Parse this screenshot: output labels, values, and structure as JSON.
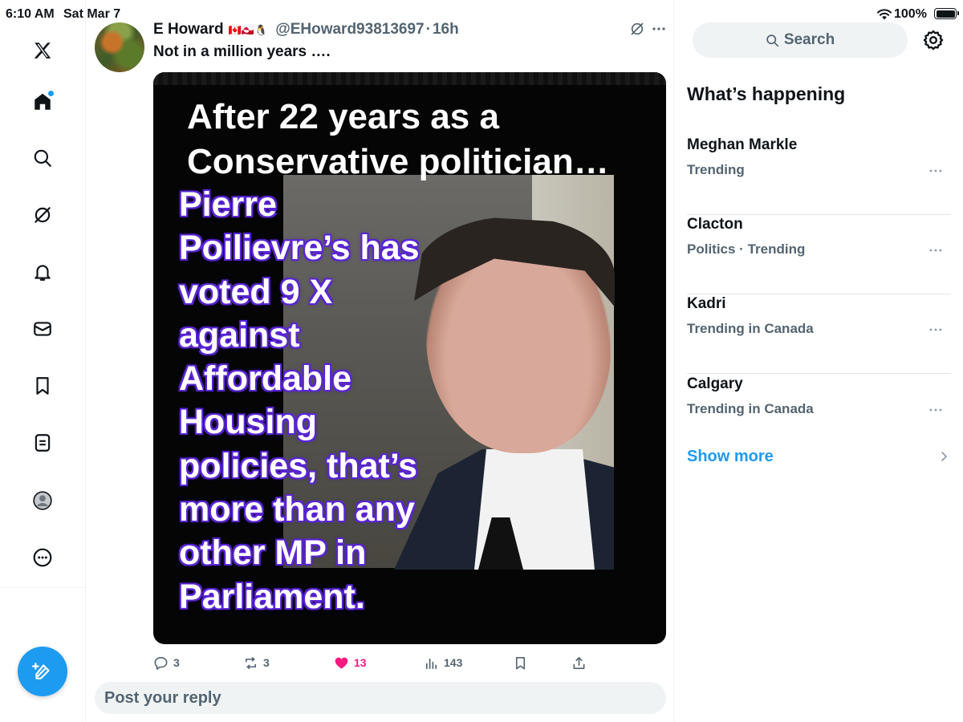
{
  "status_bar": {
    "time": "6:10 AM",
    "date": "Sat Mar 7",
    "battery": "100%"
  },
  "nav": {
    "items": [
      "x-logo",
      "home",
      "explore",
      "grok",
      "notifications",
      "messages",
      "bookmarks",
      "lists",
      "profile",
      "more"
    ],
    "home_has_notification": true
  },
  "tweet": {
    "author_name": "E Howard",
    "author_flags": "🇨🇦🇬🇱🐧",
    "author_handle": "@EHoward93813697",
    "separator": "·",
    "time_ago": "16h",
    "text": "Not in a million years ….",
    "image": {
      "headline_line1": "After 22 years as a",
      "headline_line2": "Conservative politician…",
      "body_lines": [
        "Pierre",
        "Poilievre’s has",
        "voted 9 X",
        "against",
        "Affordable",
        "Housing",
        "policies, that’s",
        "more than any",
        "other MP in",
        "Parliament."
      ]
    },
    "stats": {
      "replies": "3",
      "reposts": "3",
      "likes": "13",
      "views": "143"
    },
    "liked": true
  },
  "reply_placeholder": "Post your reply",
  "sidebar": {
    "search_label": "Search",
    "section_title": "What’s happening",
    "trends": [
      {
        "name": "Meghan Markle",
        "meta": "Trending"
      },
      {
        "name": "Clacton",
        "meta": "Politics · Trending"
      },
      {
        "name": "Kadri",
        "meta": "Trending in Canada"
      },
      {
        "name": "Calgary",
        "meta": "Trending in Canada"
      }
    ],
    "show_more": "Show more"
  },
  "colors": {
    "accent": "#1d9bf0",
    "like": "#f91880",
    "muted": "#536471",
    "text_outline": "#5a24d6"
  }
}
